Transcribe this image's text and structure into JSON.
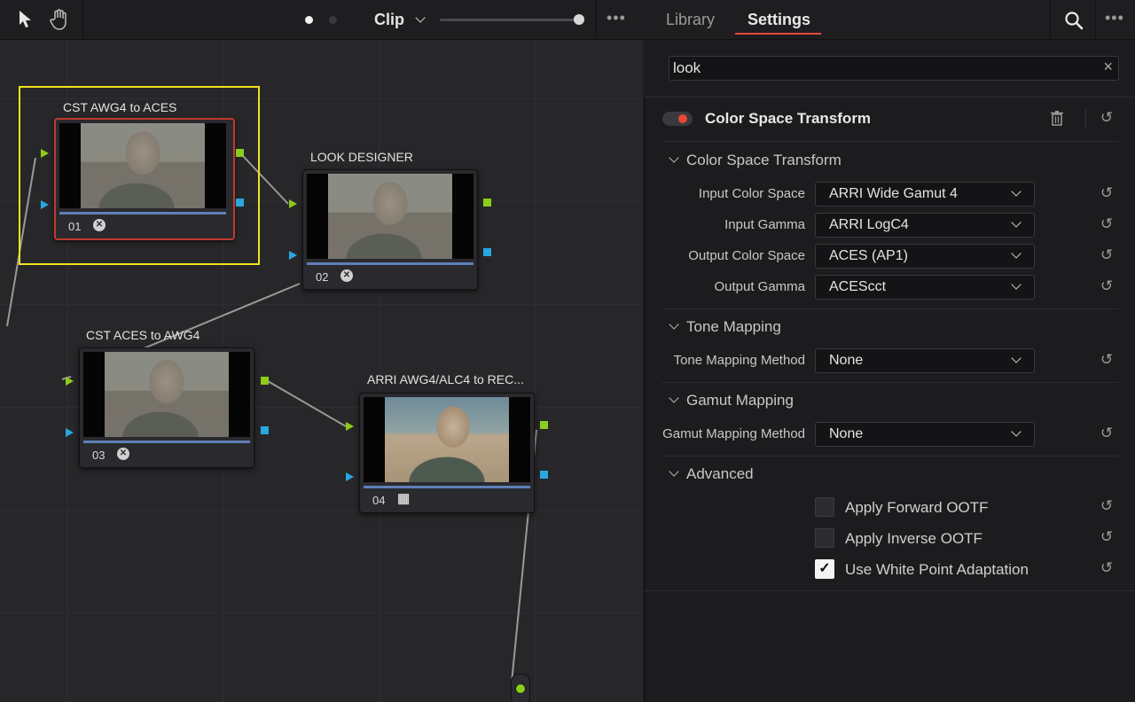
{
  "node_editor": {
    "mode_label": "Clip",
    "more_label": "•••",
    "nodes": [
      {
        "label": "CST AWG4 to ACES",
        "number": "01"
      },
      {
        "label": "LOOK DESIGNER",
        "number": "02"
      },
      {
        "label": "CST ACES to AWG4",
        "number": "03"
      },
      {
        "label": "ARRI AWG4/ALC4 to REC...",
        "number": "04"
      }
    ]
  },
  "inspector": {
    "tabs": [
      "Library",
      "Settings"
    ],
    "active_tab": "Settings",
    "more_label": "•••",
    "search": {
      "value": "look",
      "clear_label": "×"
    },
    "effect_title": "Color Space Transform",
    "sections": {
      "cst": "Color Space Transform",
      "tone": "Tone Mapping",
      "gamut": "Gamut Mapping",
      "advanced": "Advanced"
    },
    "fields": {
      "input_color_space": {
        "label": "Input Color Space",
        "value": "ARRI Wide Gamut 4"
      },
      "input_gamma": {
        "label": "Input Gamma",
        "value": "ARRI LogC4"
      },
      "output_color_space": {
        "label": "Output Color Space",
        "value": "ACES (AP1)"
      },
      "output_gamma": {
        "label": "Output Gamma",
        "value": "ACEScct"
      },
      "tone_mapping_method": {
        "label": "Tone Mapping Method",
        "value": "None"
      },
      "gamut_mapping_method": {
        "label": "Gamut Mapping Method",
        "value": "None"
      }
    },
    "checkboxes": [
      {
        "label": "Apply Forward OOTF",
        "checked": false
      },
      {
        "label": "Apply Inverse OOTF",
        "checked": false
      },
      {
        "label": "Use White Point Adaptation",
        "checked": true
      }
    ],
    "colors": {
      "accent_red": "#e8473a",
      "node_selected_outline": "#f2e11e",
      "port_green": "#8ccc1a",
      "port_blue": "#28a7e0"
    }
  }
}
